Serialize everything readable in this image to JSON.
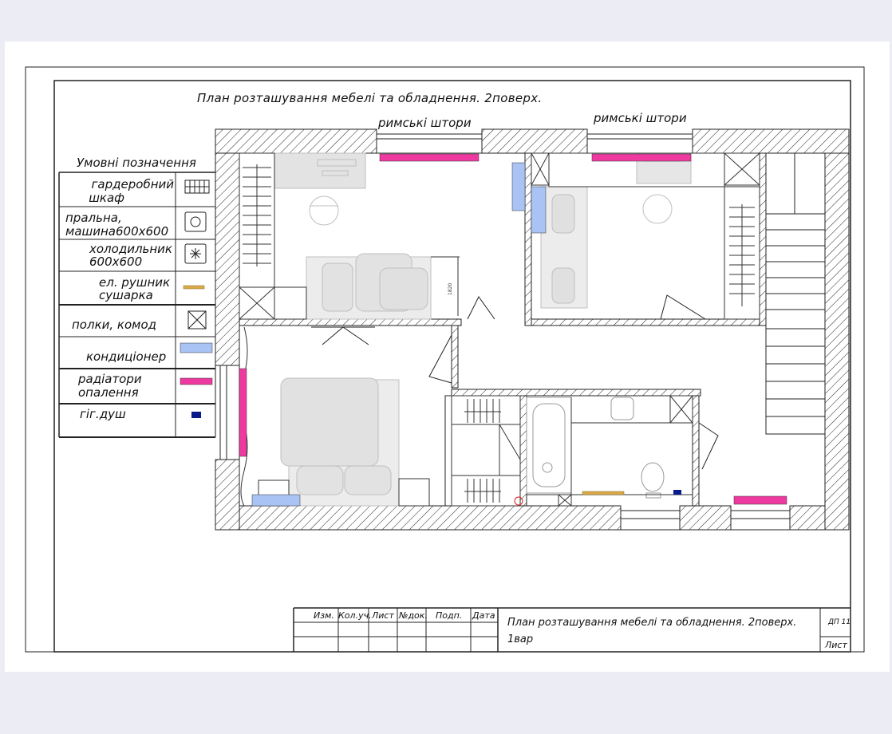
{
  "sheet_title": "План розташування мебелі та обладнення. 2поверх.",
  "blind_labels": [
    "римські штори",
    "римські штори"
  ],
  "legend": {
    "title": "Умовні позначення",
    "items": [
      {
        "line1": "гардеробний",
        "line2": "шкаф",
        "icon": "wardrobe-icon"
      },
      {
        "line1": "пральна,",
        "line2": "машина600х600",
        "icon": "washing-machine-icon"
      },
      {
        "line1": "холодильник",
        "line2": "600х600",
        "icon": "fridge-icon"
      },
      {
        "line1": "ел. рушник",
        "line2": "сушарка",
        "icon": "towel-dryer-icon"
      },
      {
        "line1": "полки, комод",
        "line2": "",
        "icon": "shelves-icon"
      },
      {
        "line1": "кондиціонер",
        "line2": "",
        "icon": "air-conditioner-icon",
        "color": "#a9c3f5"
      },
      {
        "line1": "радіатори",
        "line2": "опалення",
        "icon": "radiator-icon",
        "color": "#ee3aa0"
      },
      {
        "line1": "гіг.душ",
        "line2": "",
        "icon": "hygienic-shower-icon",
        "color": "#0a1a8a"
      }
    ]
  },
  "dimension_label": "1820",
  "title_block": {
    "headers": [
      "Изм.",
      "Кол.уч.",
      "Лист",
      "№док.",
      "Подп.",
      "Дата"
    ],
    "description_line1": "План розташування мебелі та обладнення. 2поверх.",
    "description_line2": "1вар",
    "code": "ДП 11",
    "sheet_label": "Лист"
  },
  "colors": {
    "radiator": "#ee3aa0",
    "air_conditioner": "#a9c3f5",
    "hygienic_shower": "#0a1a8a",
    "towel_dryer": "#d9a94a",
    "furniture": "#d4d4d4"
  }
}
